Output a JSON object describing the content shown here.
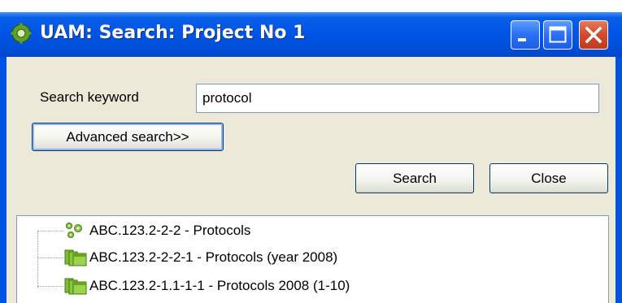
{
  "window": {
    "title": "UAM: Search: Project No 1",
    "title_bar_color": "#0054e3",
    "buttons": {
      "minimize": "minimize-icon",
      "maximize": "maximize-icon",
      "close": "close-icon"
    }
  },
  "search": {
    "keyword_label": "Search keyword",
    "keyword_value": "protocol",
    "advanced_label": "Advanced search>>",
    "search_label": "Search",
    "close_label": "Close"
  },
  "results": {
    "items": [
      {
        "label": "ABC.123.2-2-2 - Protocols",
        "icon": "gear-cluster-icon",
        "icon_color": "#6aa317"
      },
      {
        "label": "ABC.123.2-2-2-1 - Protocols (year 2008)",
        "icon": "folders-icon",
        "icon_color": "#6aa317"
      },
      {
        "label": "ABC.123.2-1.1-1-1 - Protocols 2008 (1-10)",
        "icon": "folders-icon",
        "icon_color": "#6aa317"
      }
    ]
  }
}
